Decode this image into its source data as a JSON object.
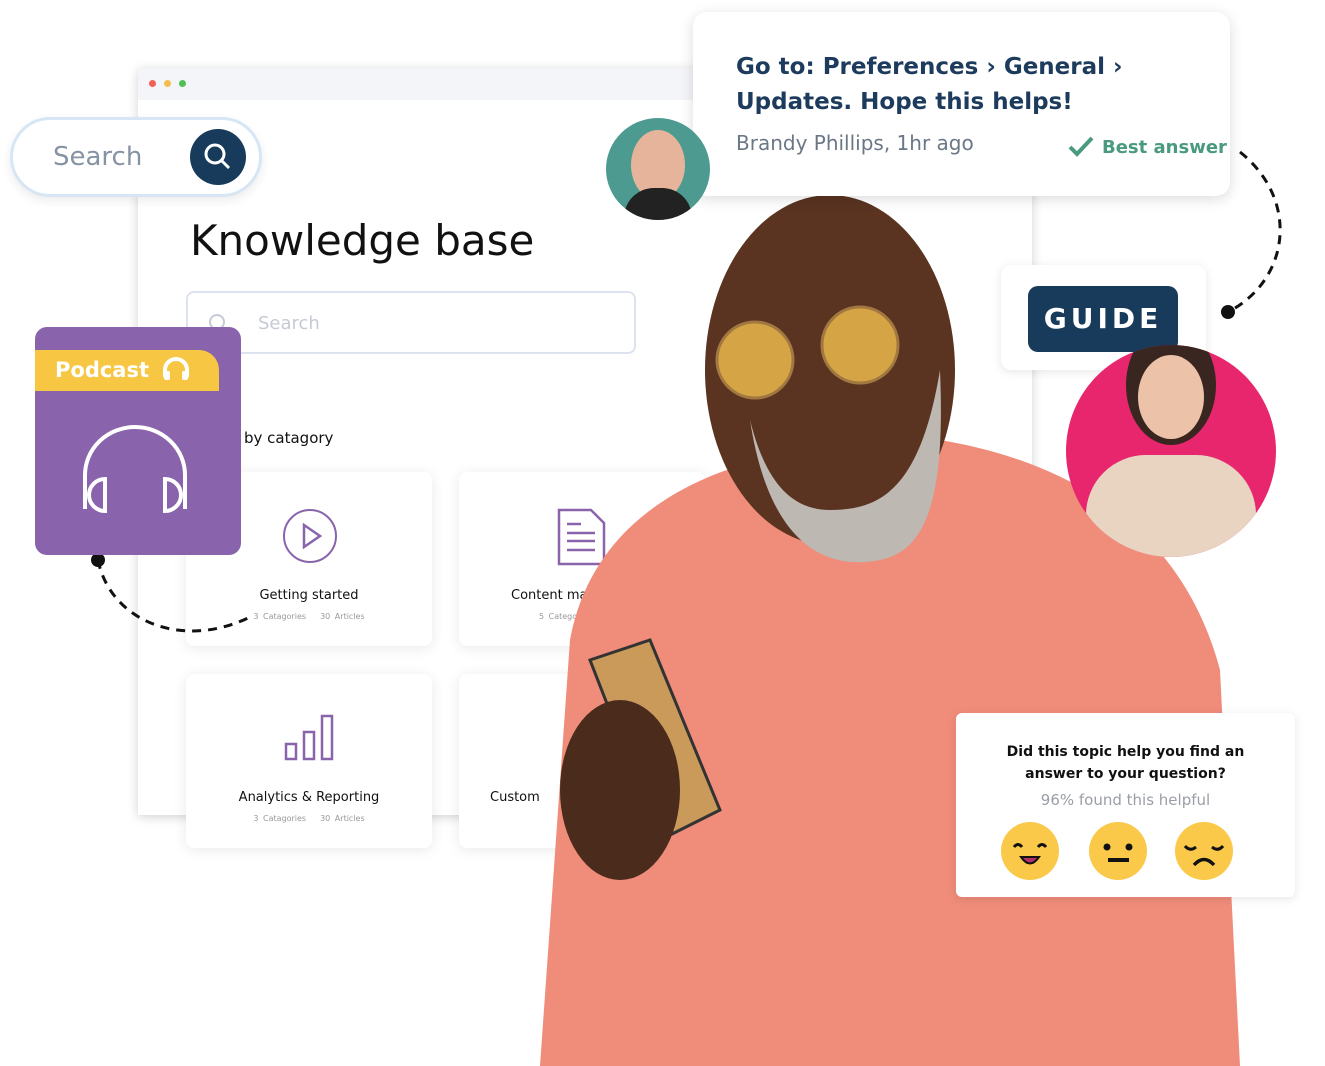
{
  "search_pill": {
    "placeholder": "Search",
    "icon": "search-icon"
  },
  "knowledge_base": {
    "title": "Knowledge base",
    "search_placeholder": "Search",
    "section_label": "by catagory",
    "cards": [
      {
        "name": "Getting started",
        "categories": "3 Catagories",
        "articles": "30 Articles",
        "icon": "play-circle-icon"
      },
      {
        "name": "Content ma",
        "categories": "5 Categorie",
        "articles": "",
        "icon": "document-icon"
      },
      {
        "name": "Analytics & Reporting",
        "categories": "3 Catagories",
        "articles": "30 Articles",
        "icon": "bar-chart-icon"
      },
      {
        "name": "Custom",
        "categories": "",
        "articles": "",
        "icon": ""
      }
    ]
  },
  "podcast": {
    "label": "Podcast",
    "icon": "headphones-icon",
    "color": "#8a63ad",
    "tab_color": "#f7c744"
  },
  "answer": {
    "text_line1": "Go to: Preferences › General ›",
    "text_line2": "Updates. Hope this helps!",
    "author": "Brandy Phillips, 1hr ago",
    "badge": "Best answer"
  },
  "guide": {
    "label": "GUIDE"
  },
  "feedback": {
    "question_line1": "Did this topic help you find an",
    "question_line2": "answer to your question?",
    "stat": "96% found this helpful",
    "options": [
      "happy-face-icon",
      "neutral-face-icon",
      "sad-face-icon"
    ]
  },
  "colors": {
    "navy": "#183b5c",
    "green": "#4a9a80",
    "pink": "#e8266e",
    "shirt": "#f08c7a"
  }
}
